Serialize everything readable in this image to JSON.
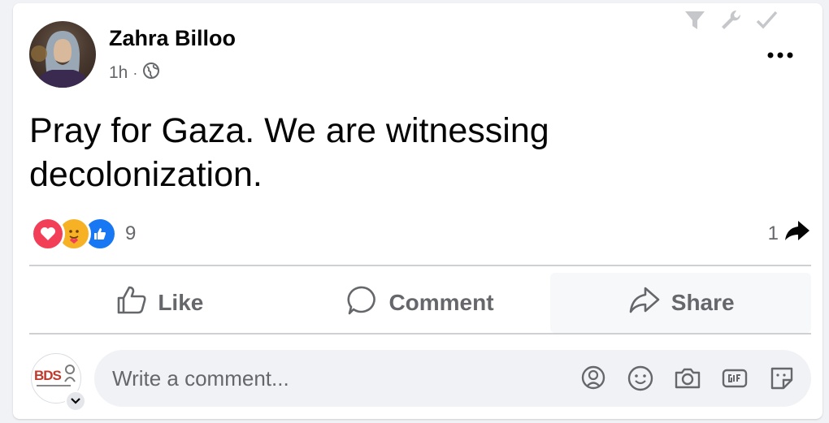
{
  "post": {
    "author": "Zahra Billoo",
    "time": "1h",
    "separator": "·",
    "text": "Pray for Gaza. We are witnessing decolonization.",
    "reaction_count": "9",
    "share_count": "1"
  },
  "actions": {
    "like": "Like",
    "comment": "Comment",
    "share": "Share"
  },
  "comment_box": {
    "placeholder": "Write a comment...",
    "avatar_text": "BDS"
  },
  "icons": {
    "reactions": [
      "love-icon",
      "care-icon",
      "like-reaction-icon"
    ],
    "top_tools": [
      "filter-icon",
      "wrench-icon",
      "checkmark-icon"
    ],
    "comment_tools": [
      "avatar-sticker-icon",
      "emoji-icon",
      "camera-icon",
      "gif-icon",
      "sticker-icon"
    ]
  },
  "colors": {
    "like_blue": "#1877f2",
    "love_red": "#f33e58",
    "care_yellow": "#f7b125",
    "secondary_text": "#65676b"
  }
}
